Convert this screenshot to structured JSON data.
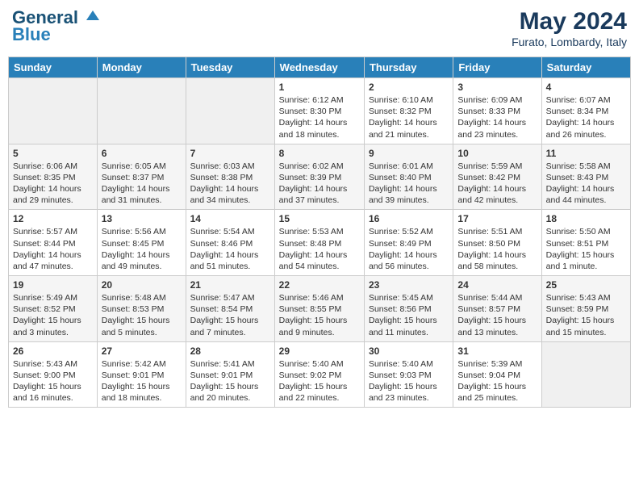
{
  "header": {
    "logo_line1": "General",
    "logo_line2": "Blue",
    "month": "May 2024",
    "location": "Furato, Lombardy, Italy"
  },
  "weekdays": [
    "Sunday",
    "Monday",
    "Tuesday",
    "Wednesday",
    "Thursday",
    "Friday",
    "Saturday"
  ],
  "weeks": [
    [
      {
        "day": "",
        "content": ""
      },
      {
        "day": "",
        "content": ""
      },
      {
        "day": "",
        "content": ""
      },
      {
        "day": "1",
        "content": "Sunrise: 6:12 AM\nSunset: 8:30 PM\nDaylight: 14 hours\nand 18 minutes."
      },
      {
        "day": "2",
        "content": "Sunrise: 6:10 AM\nSunset: 8:32 PM\nDaylight: 14 hours\nand 21 minutes."
      },
      {
        "day": "3",
        "content": "Sunrise: 6:09 AM\nSunset: 8:33 PM\nDaylight: 14 hours\nand 23 minutes."
      },
      {
        "day": "4",
        "content": "Sunrise: 6:07 AM\nSunset: 8:34 PM\nDaylight: 14 hours\nand 26 minutes."
      }
    ],
    [
      {
        "day": "5",
        "content": "Sunrise: 6:06 AM\nSunset: 8:35 PM\nDaylight: 14 hours\nand 29 minutes."
      },
      {
        "day": "6",
        "content": "Sunrise: 6:05 AM\nSunset: 8:37 PM\nDaylight: 14 hours\nand 31 minutes."
      },
      {
        "day": "7",
        "content": "Sunrise: 6:03 AM\nSunset: 8:38 PM\nDaylight: 14 hours\nand 34 minutes."
      },
      {
        "day": "8",
        "content": "Sunrise: 6:02 AM\nSunset: 8:39 PM\nDaylight: 14 hours\nand 37 minutes."
      },
      {
        "day": "9",
        "content": "Sunrise: 6:01 AM\nSunset: 8:40 PM\nDaylight: 14 hours\nand 39 minutes."
      },
      {
        "day": "10",
        "content": "Sunrise: 5:59 AM\nSunset: 8:42 PM\nDaylight: 14 hours\nand 42 minutes."
      },
      {
        "day": "11",
        "content": "Sunrise: 5:58 AM\nSunset: 8:43 PM\nDaylight: 14 hours\nand 44 minutes."
      }
    ],
    [
      {
        "day": "12",
        "content": "Sunrise: 5:57 AM\nSunset: 8:44 PM\nDaylight: 14 hours\nand 47 minutes."
      },
      {
        "day": "13",
        "content": "Sunrise: 5:56 AM\nSunset: 8:45 PM\nDaylight: 14 hours\nand 49 minutes."
      },
      {
        "day": "14",
        "content": "Sunrise: 5:54 AM\nSunset: 8:46 PM\nDaylight: 14 hours\nand 51 minutes."
      },
      {
        "day": "15",
        "content": "Sunrise: 5:53 AM\nSunset: 8:48 PM\nDaylight: 14 hours\nand 54 minutes."
      },
      {
        "day": "16",
        "content": "Sunrise: 5:52 AM\nSunset: 8:49 PM\nDaylight: 14 hours\nand 56 minutes."
      },
      {
        "day": "17",
        "content": "Sunrise: 5:51 AM\nSunset: 8:50 PM\nDaylight: 14 hours\nand 58 minutes."
      },
      {
        "day": "18",
        "content": "Sunrise: 5:50 AM\nSunset: 8:51 PM\nDaylight: 15 hours\nand 1 minute."
      }
    ],
    [
      {
        "day": "19",
        "content": "Sunrise: 5:49 AM\nSunset: 8:52 PM\nDaylight: 15 hours\nand 3 minutes."
      },
      {
        "day": "20",
        "content": "Sunrise: 5:48 AM\nSunset: 8:53 PM\nDaylight: 15 hours\nand 5 minutes."
      },
      {
        "day": "21",
        "content": "Sunrise: 5:47 AM\nSunset: 8:54 PM\nDaylight: 15 hours\nand 7 minutes."
      },
      {
        "day": "22",
        "content": "Sunrise: 5:46 AM\nSunset: 8:55 PM\nDaylight: 15 hours\nand 9 minutes."
      },
      {
        "day": "23",
        "content": "Sunrise: 5:45 AM\nSunset: 8:56 PM\nDaylight: 15 hours\nand 11 minutes."
      },
      {
        "day": "24",
        "content": "Sunrise: 5:44 AM\nSunset: 8:57 PM\nDaylight: 15 hours\nand 13 minutes."
      },
      {
        "day": "25",
        "content": "Sunrise: 5:43 AM\nSunset: 8:59 PM\nDaylight: 15 hours\nand 15 minutes."
      }
    ],
    [
      {
        "day": "26",
        "content": "Sunrise: 5:43 AM\nSunset: 9:00 PM\nDaylight: 15 hours\nand 16 minutes."
      },
      {
        "day": "27",
        "content": "Sunrise: 5:42 AM\nSunset: 9:01 PM\nDaylight: 15 hours\nand 18 minutes."
      },
      {
        "day": "28",
        "content": "Sunrise: 5:41 AM\nSunset: 9:01 PM\nDaylight: 15 hours\nand 20 minutes."
      },
      {
        "day": "29",
        "content": "Sunrise: 5:40 AM\nSunset: 9:02 PM\nDaylight: 15 hours\nand 22 minutes."
      },
      {
        "day": "30",
        "content": "Sunrise: 5:40 AM\nSunset: 9:03 PM\nDaylight: 15 hours\nand 23 minutes."
      },
      {
        "day": "31",
        "content": "Sunrise: 5:39 AM\nSunset: 9:04 PM\nDaylight: 15 hours\nand 25 minutes."
      },
      {
        "day": "",
        "content": ""
      }
    ]
  ]
}
